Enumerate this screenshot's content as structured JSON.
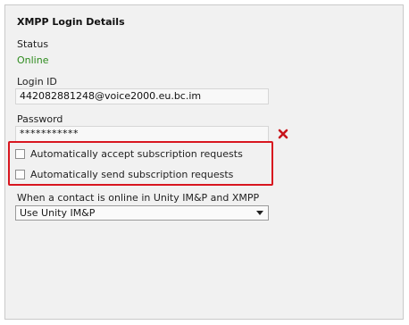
{
  "section": {
    "title": "XMPP Login Details"
  },
  "status": {
    "label": "Status",
    "value": "Online",
    "value_color": "#2e8b1e"
  },
  "login": {
    "label": "Login ID",
    "value": "442082881248@voice2000.eu.bc.im"
  },
  "password": {
    "label": "Password",
    "value": "***********",
    "clear_icon": "red-x-icon"
  },
  "options": {
    "auto_accept": {
      "label": "Automatically accept subscription requests",
      "checked": false
    },
    "auto_send": {
      "label": "Automatically send subscription requests",
      "checked": false
    },
    "highlight_color": "#d8161f"
  },
  "contact_online": {
    "label": "When a contact is online in Unity IM&P and XMPP",
    "selected": "Use Unity IM&P"
  }
}
